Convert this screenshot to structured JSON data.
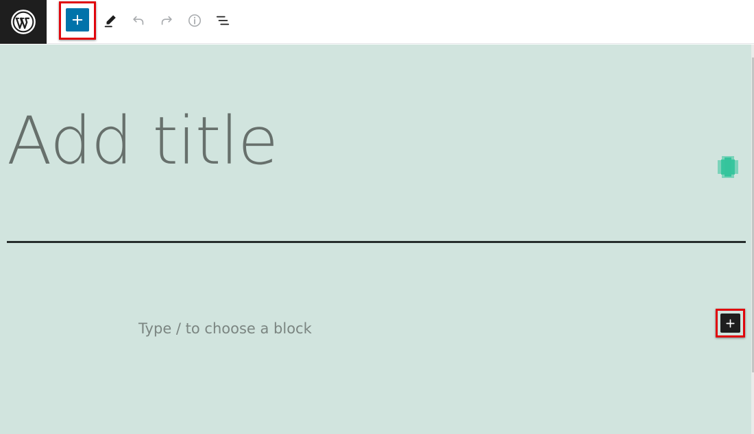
{
  "toolbar": {
    "logo_icon": "wordpress-logo-icon",
    "inserter_icon": "plus-icon",
    "inserter_color": "#0073aa",
    "highlight_color": "#e0050c",
    "tools": [
      {
        "name": "tools-pen-icon"
      },
      {
        "name": "undo-icon"
      },
      {
        "name": "redo-icon"
      },
      {
        "name": "info-icon"
      },
      {
        "name": "list-view-icon"
      }
    ]
  },
  "editor": {
    "background_color": "#d1e4de",
    "title_placeholder": "Add title",
    "block_placeholder": "Type / to choose a block",
    "block_inserter_icon": "plus-icon"
  }
}
